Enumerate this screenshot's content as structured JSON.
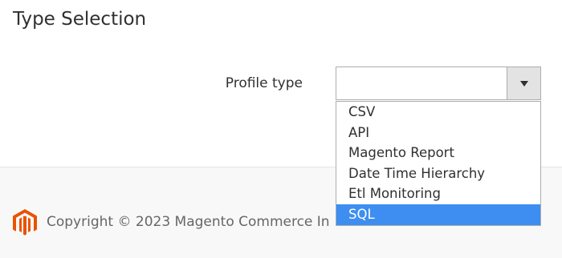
{
  "section": {
    "title": "Type Selection"
  },
  "form": {
    "profile_type_label": "Profile type",
    "profile_type_value": ""
  },
  "dropdown": {
    "options": [
      {
        "label": "CSV",
        "selected": false
      },
      {
        "label": "API",
        "selected": false
      },
      {
        "label": "Magento Report",
        "selected": false
      },
      {
        "label": "Date Time Hierarchy",
        "selected": false
      },
      {
        "label": "Etl Monitoring",
        "selected": false
      },
      {
        "label": "SQL",
        "selected": true
      }
    ]
  },
  "footer": {
    "copyright": "Copyright © 2023 Magento Commerce In",
    "logo_icon": "magento-logo-icon",
    "logo_color": "#eb5202"
  },
  "colors": {
    "highlight": "#3d8ef0",
    "footer_bg": "#f8f8f8",
    "text": "#303030"
  }
}
